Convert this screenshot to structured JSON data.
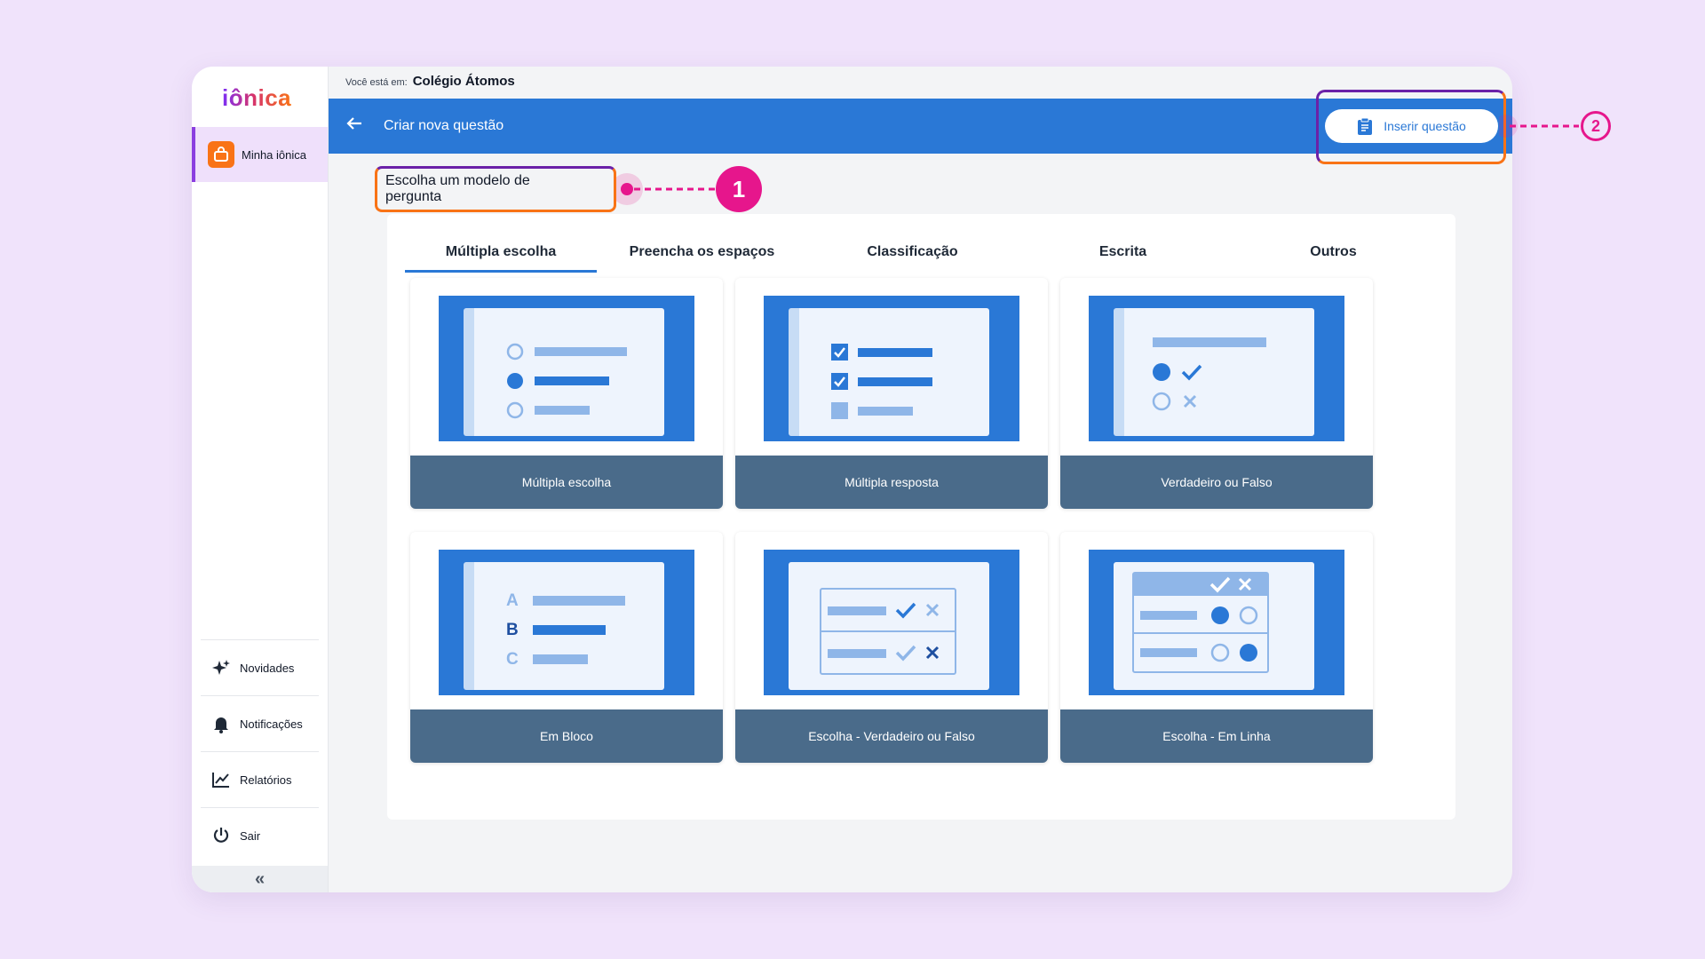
{
  "sidebar": {
    "logo": "iônica",
    "home_label": "Minha iônica",
    "bottom_items": [
      {
        "label": "Novidades",
        "icon": "sparkles-icon"
      },
      {
        "label": "Notificações",
        "icon": "bell-icon"
      },
      {
        "label": "Relatórios",
        "icon": "chart-line-icon"
      },
      {
        "label": "Sair",
        "icon": "power-icon"
      }
    ],
    "collapse_glyph": "«"
  },
  "breadcrumb": {
    "label": "Você está em:",
    "value": "Colégio Átomos"
  },
  "topbar": {
    "title": "Criar nova questão",
    "insert_button": "Inserir questão"
  },
  "main": {
    "heading": "Escolha um modelo de pergunta",
    "tabs": [
      "Múltipla escolha",
      "Preencha os espaços",
      "Classificação",
      "Escrita",
      "Outros"
    ],
    "active_tab": "Múltipla escolha",
    "cards": [
      "Múltipla escolha",
      "Múltipla resposta",
      "Verdadeiro ou Falso",
      "Em Bloco",
      "Escolha - Verdadeiro ou Falso",
      "Escolha - Em Linha"
    ],
    "block_letters": [
      "A",
      "B",
      "C"
    ]
  },
  "annotations": {
    "step1": "1",
    "step2": "2"
  },
  "colors": {
    "primary": "#2a78d6",
    "caption_bg": "#4a6b8a",
    "accent_pink": "#e6168c",
    "accent_orange": "#f97316",
    "accent_purple": "#6b21a8",
    "background": "#f0e3fb"
  }
}
